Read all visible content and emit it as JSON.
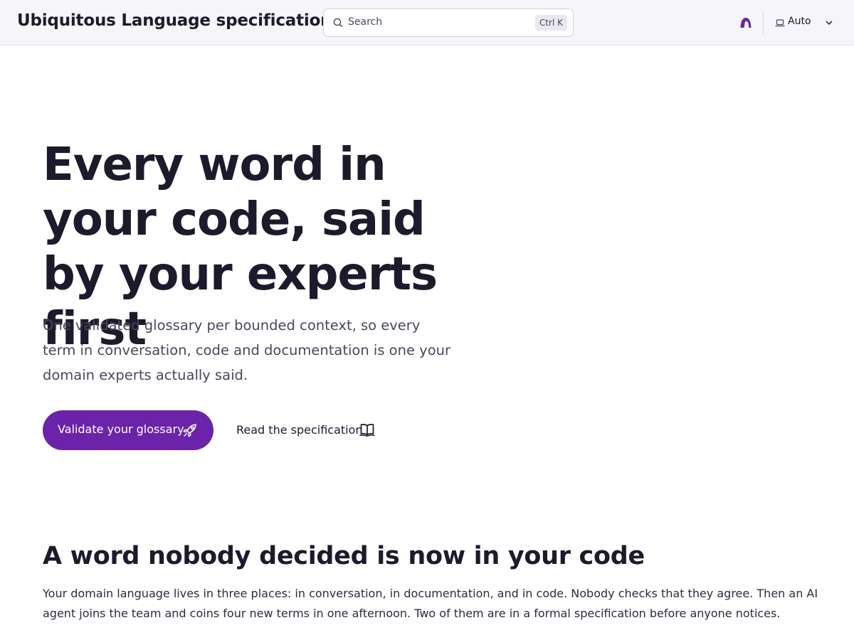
{
  "header": {
    "site_title": "Ubiquitous Language specification",
    "search": {
      "placeholder": "Search",
      "shortcut": "Ctrl K",
      "icon": "search-icon"
    },
    "brand_icon": "arch-logo-icon",
    "theme": {
      "label": "Auto",
      "icon": "laptop-icon"
    }
  },
  "hero": {
    "title": "Every word in your code, said by your experts first",
    "lead": "One validated glossary per bounded context, so every term in conversation, code and documentation is one your domain experts actually said.",
    "primary_cta": {
      "label": "Validate your glossary",
      "icon": "rocket-icon"
    },
    "secondary_cta": {
      "label": "Read the specification",
      "icon": "book-icon"
    }
  },
  "problem": {
    "title": "A word nobody decided is now in your code",
    "body": "Your domain language lives in three places: in conversation, in documentation, and in code. Nobody checks that they agree. Then an AI agent joins the team and coins four new terms in one afternoon. Two of them are in a formal specification before anyone notices."
  },
  "colors": {
    "accent": "#6b23a9",
    "text": "#1c1a2b",
    "muted_text": "#4a475a",
    "header_bg": "#f6f5fa"
  }
}
